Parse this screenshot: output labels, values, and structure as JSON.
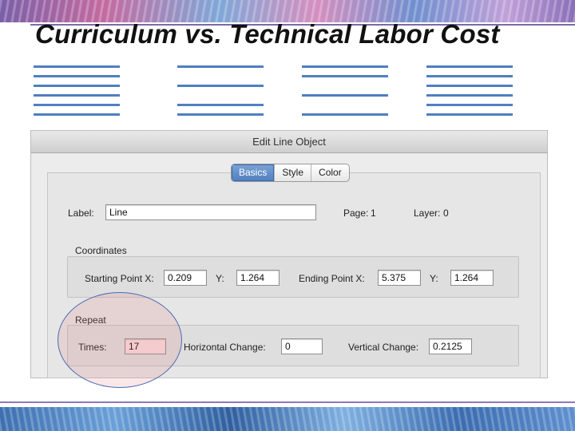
{
  "slide": {
    "title": "Curriculum vs. Technical Labor Cost"
  },
  "dialog": {
    "title": "Edit Line Object",
    "tabs": [
      {
        "label": "Basics",
        "active": true
      },
      {
        "label": "Style",
        "active": false
      },
      {
        "label": "Color",
        "active": false
      }
    ],
    "label_caption": "Label:",
    "label_value": "Line",
    "page_caption": "Page:",
    "page_value": "1",
    "layer_caption": "Layer:",
    "layer_value": "0",
    "coordinates": {
      "heading": "Coordinates",
      "start_x_caption": "Starting Point X:",
      "start_x_value": "0.209",
      "start_y_caption": "Y:",
      "start_y_value": "1.264",
      "end_x_caption": "Ending Point X:",
      "end_x_value": "5.375",
      "end_y_caption": "Y:",
      "end_y_value": "1.264"
    },
    "repeat": {
      "heading": "Repeat",
      "times_caption": "Times:",
      "times_value": "17",
      "horizontal_caption": "Horizontal Change:",
      "horizontal_value": "0",
      "vertical_caption": "Vertical Change:",
      "vertical_value": "0.2125"
    }
  },
  "colors": {
    "line_blue": "#4f7fc0",
    "tab_active": "#5a88c6",
    "highlight_circle": "#4b6db3",
    "times_field_bg": "#f8dede"
  }
}
